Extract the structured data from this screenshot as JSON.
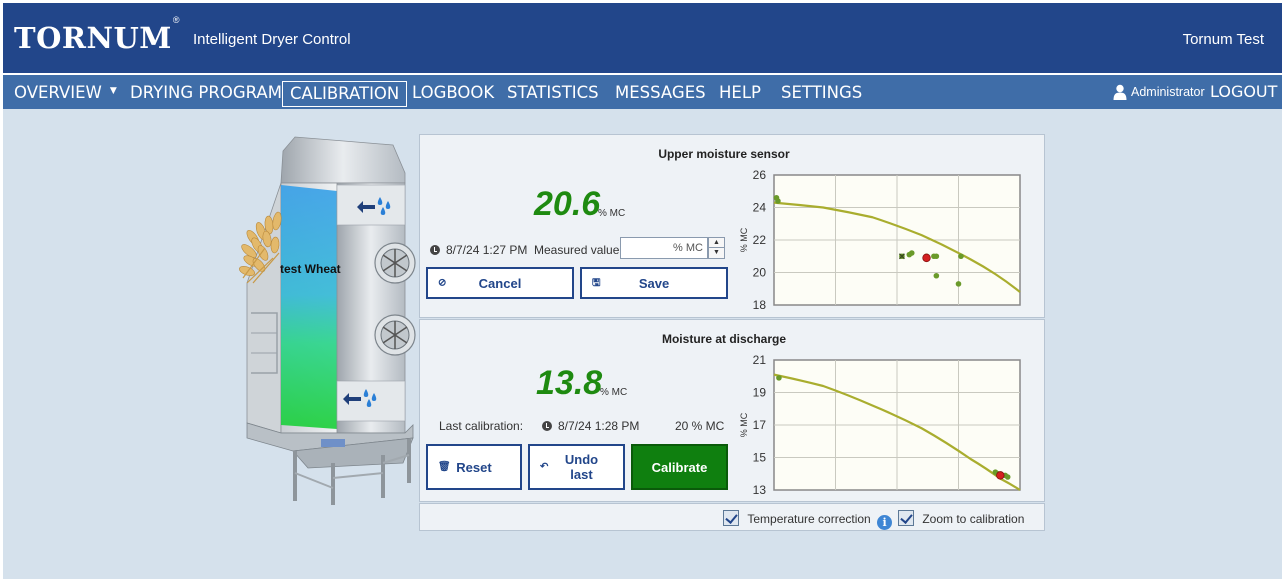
{
  "header": {
    "logo": "TORNUM",
    "logo_mark": "®",
    "app_title": "Intelligent Dryer Control",
    "site_name": "Tornum Test"
  },
  "nav": {
    "items": [
      {
        "label": "OVERVIEW",
        "caret": "▼"
      },
      {
        "label": "DRYING PROGRAM"
      },
      {
        "label": "CALIBRATION",
        "active": true
      },
      {
        "label": "LOGBOOK"
      },
      {
        "label": "STATISTICS"
      },
      {
        "label": "MESSAGES"
      },
      {
        "label": "HELP"
      },
      {
        "label": "SETTINGS"
      }
    ],
    "user": "Administrator",
    "logout": "LOGOUT"
  },
  "dryer": {
    "grain_label": "test Wheat"
  },
  "upper": {
    "title": "Upper moisture sensor",
    "value": "20.6",
    "unit": "% MC",
    "timestamp": "8/7/24 1:27 PM",
    "measured_label": "Measured value",
    "input_placeholder": "% MC",
    "cancel": "Cancel",
    "save": "Save",
    "chart_ylabel": "% MC"
  },
  "discharge": {
    "title": "Moisture at discharge",
    "value": "13.8",
    "unit": "% MC",
    "last_cal_label": "Last calibration:",
    "last_cal_time": "8/7/24 1:28 PM",
    "last_cal_value": "20 % MC",
    "reset": "Reset",
    "undo": "Undo last",
    "calibrate": "Calibrate",
    "chart_ylabel": "% MC"
  },
  "options": {
    "temp_correction": "Temperature correction",
    "zoom": "Zoom to calibration",
    "info_glyph": "i"
  },
  "colors": {
    "header": "#22468a",
    "nav": "#3f6da8",
    "value_green": "#1e8a10",
    "curve": "#a9ad2e",
    "point": "#6a9a2a",
    "current_point": "#d42020"
  },
  "chart_data": [
    {
      "type": "scatter",
      "title": "",
      "ylabel": "% MC",
      "ylim": [
        18,
        26
      ],
      "yticks": [
        18,
        20,
        22,
        24,
        26
      ],
      "xlim": [
        0,
        5
      ],
      "grid": true,
      "curve": [
        [
          0,
          24.3
        ],
        [
          1,
          24.0
        ],
        [
          2,
          23.4
        ],
        [
          3,
          22.3
        ],
        [
          4,
          20.8
        ],
        [
          4.5,
          19.9
        ],
        [
          5,
          18.8
        ]
      ],
      "points": [
        [
          0.05,
          24.6
        ],
        [
          0.08,
          24.4
        ],
        [
          2.6,
          21.0
        ],
        [
          2.75,
          21.1
        ],
        [
          2.8,
          21.2
        ],
        [
          3.1,
          21.0
        ],
        [
          3.25,
          21.0
        ],
        [
          3.3,
          21.0
        ],
        [
          3.3,
          19.8
        ],
        [
          3.75,
          19.3
        ],
        [
          3.8,
          21.0
        ]
      ],
      "marker_x": [
        [
          2.6,
          21.0
        ]
      ],
      "current": [
        [
          3.1,
          20.9
        ]
      ]
    },
    {
      "type": "scatter",
      "title": "",
      "ylabel": "% MC",
      "ylim": [
        13,
        21
      ],
      "yticks": [
        13,
        15,
        17,
        19,
        21
      ],
      "xlim": [
        0,
        5
      ],
      "grid": true,
      "curve": [
        [
          0,
          20.1
        ],
        [
          1,
          19.4
        ],
        [
          2,
          18.2
        ],
        [
          3,
          16.8
        ],
        [
          4,
          14.9
        ],
        [
          4.6,
          13.7
        ],
        [
          5,
          13.0
        ]
      ],
      "points": [
        [
          0.1,
          19.9
        ],
        [
          4.5,
          14.1
        ],
        [
          4.55,
          14.0
        ],
        [
          4.7,
          13.9
        ],
        [
          4.75,
          13.8
        ]
      ],
      "current": [
        [
          4.6,
          13.9
        ]
      ]
    }
  ]
}
